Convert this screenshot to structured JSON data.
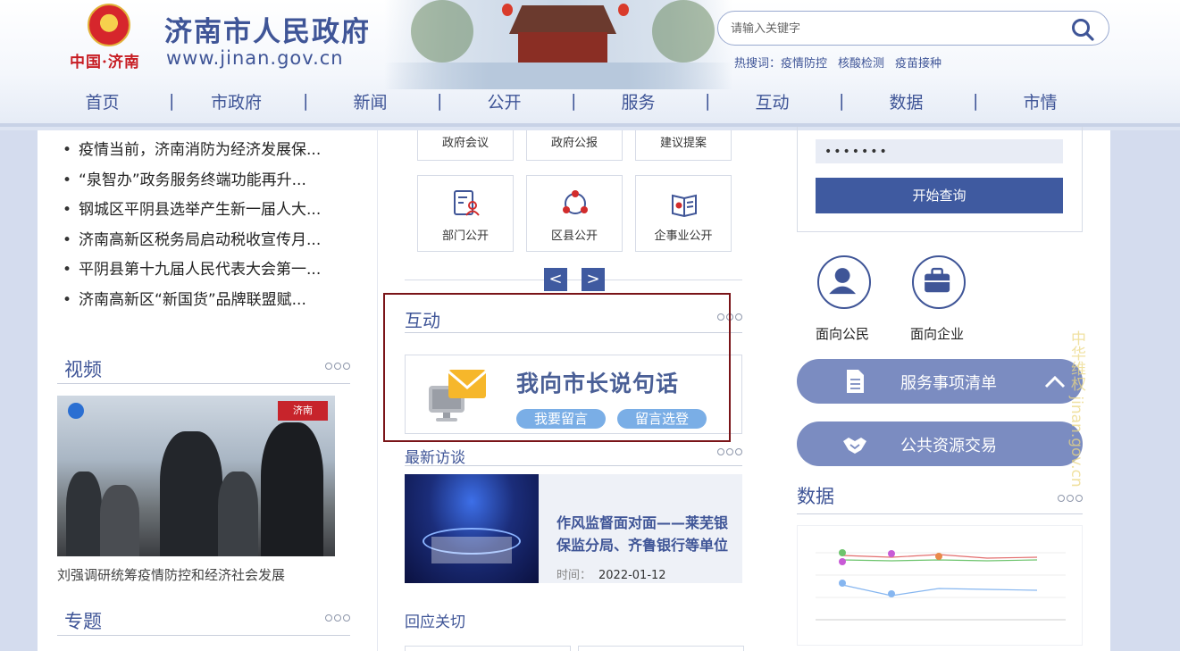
{
  "header": {
    "site_title": "济南市人民政府",
    "site_url": "www.jinan.gov.cn",
    "city_mark": "中国·济南",
    "search": {
      "placeholder": "请输入关键字"
    },
    "hot_search": {
      "label": "热搜词：",
      "terms": [
        "疫情防控",
        "核酸检测",
        "疫苗接种"
      ]
    },
    "nav": [
      "首页",
      "市政府",
      "新闻",
      "公开",
      "服务",
      "互动",
      "数据",
      "市情"
    ]
  },
  "left": {
    "news": [
      "疫情当前，济南消防为经济发展保...",
      "“泉智办”政务服务终端功能再升...",
      "钢城区平阴县选举产生新一届人大...",
      "济南高新区税务局启动税收宣传月...",
      "平阴县第十九届人民代表大会第一...",
      "济南高新区“新国货”品牌联盟赋..."
    ],
    "video": {
      "title": "视频",
      "caption": "刘强调研统筹疫情防控和经济社会发展",
      "logo": "济南"
    },
    "topic": {
      "title": "专题"
    }
  },
  "middle": {
    "top_tiles": [
      "政府会议",
      "政府公报",
      "建议提案"
    ],
    "tiles": [
      "部门公开",
      "区县公开",
      "企事业公开"
    ],
    "arrows": {
      "prev": "<",
      "next": ">"
    },
    "interact": {
      "title": "互动",
      "mayor_title": "我向市长说句话",
      "leave_msg": "我要留言",
      "msg_list": "留言选登"
    },
    "visit": {
      "title": "最新访谈",
      "headline": "作风监督面对面——莱芜银保监分局、齐鲁银行等单位",
      "date_label": "时间：",
      "date": "2022-01-12"
    },
    "response": {
      "title": "回应关切"
    }
  },
  "right": {
    "login": {
      "password_mask": "•••••••",
      "query_btn": "开始查询"
    },
    "roles": [
      "面向公民",
      "面向企业"
    ],
    "services": [
      "服务事项清单",
      "公共资源交易"
    ],
    "vertical_text": "中华维权 jinan.gov.cn",
    "data_title": "数据"
  },
  "colors": {
    "brand": "#3f5597",
    "button": "#3f5aa0",
    "highlight_frame": "#7a1418",
    "pill": "#7aaee6",
    "service_bar": "#7b8cc1"
  }
}
